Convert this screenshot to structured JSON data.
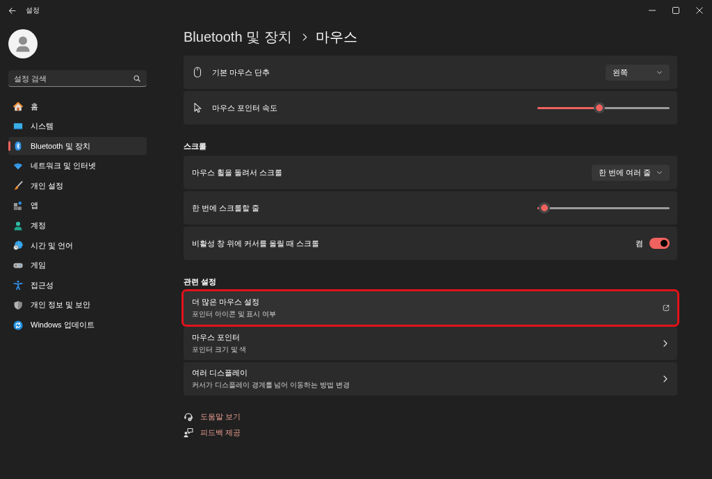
{
  "window": {
    "title": "설정"
  },
  "sidebar": {
    "search": {
      "placeholder": "설정 검색"
    },
    "items": [
      {
        "label": "홈",
        "selected": false
      },
      {
        "label": "시스템",
        "selected": false
      },
      {
        "label": "Bluetooth 및 장치",
        "selected": true
      },
      {
        "label": "네트워크 및 인터넷",
        "selected": false
      },
      {
        "label": "개인 설정",
        "selected": false
      },
      {
        "label": "앱",
        "selected": false
      },
      {
        "label": "계정",
        "selected": false
      },
      {
        "label": "시간 및 언어",
        "selected": false
      },
      {
        "label": "게임",
        "selected": false
      },
      {
        "label": "접근성",
        "selected": false
      },
      {
        "label": "개인 정보 및 보안",
        "selected": false
      },
      {
        "label": "Windows 업데이트",
        "selected": false
      }
    ]
  },
  "breadcrumb": [
    {
      "label": "Bluetooth 및 장치"
    },
    {
      "label": "마우스"
    }
  ],
  "groups": [
    {
      "rows": [
        {
          "kind": "dropdown",
          "label": "기본 마우스 단추",
          "value": "왼쪽"
        },
        {
          "kind": "slider",
          "label": "마우스 포인터 속도",
          "level": 0.47
        }
      ]
    },
    {
      "heading": "스크롤",
      "rows": [
        {
          "kind": "dropdown",
          "label": "마우스 휠을 돌려서 스크롤",
          "value": "한 번에 여러 줄"
        },
        {
          "kind": "slider",
          "label": "한 번에 스크롤할 줄",
          "level": 0.05
        },
        {
          "kind": "toggle",
          "label": "비활성 창 위에 커서를 올릴 때 스크롤",
          "on": true,
          "state_text": "켬"
        }
      ]
    },
    {
      "heading": "관련 설정",
      "rows": [
        {
          "kind": "external",
          "title": "더 많은 마우스 설정",
          "description": "포인터 아이콘 및 표시 여부",
          "highlighted": true
        },
        {
          "kind": "link",
          "title": "마우스 포인터",
          "description": "포인터 크기 및 색",
          "highlighted": false
        },
        {
          "kind": "link",
          "title": "여러 디스플레이",
          "description": "커서가 디스플레이 경계를 넘어 이동하는 방법 변경",
          "highlighted": false
        }
      ]
    }
  ],
  "help_links": [
    {
      "label": "도움말 보기"
    },
    {
      "label": "피드백 제공"
    }
  ]
}
